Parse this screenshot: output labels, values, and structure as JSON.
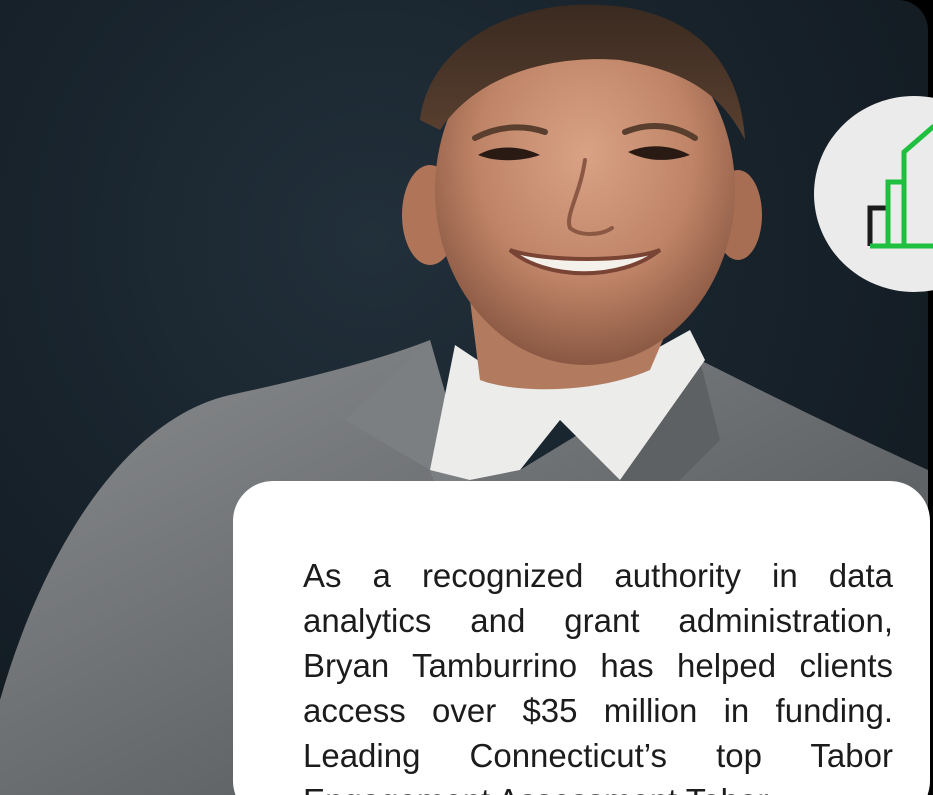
{
  "hero": {
    "photo_alt": "Portrait of Bryan Tamburrino",
    "bio_text": "As a recognized authority in data analytics and grant administration, Bryan Tamburrino has helped clients access over $35 million in funding. Leading Connecticut’s top Tabor Engagement Assessment Tabor..."
  },
  "colors": {
    "background": "#000000",
    "photo_backdrop": "#18232c",
    "suit": "#6b6e70",
    "shirt": "#ececea",
    "skin": "#c08a6e",
    "logo_badge": "#ebebeb",
    "logo_green": "#1fbf3f",
    "logo_dark": "#1c1c1c",
    "card": "#ffffff",
    "text": "#1c1c1c"
  },
  "icons": {
    "logo": "bar-building-logo-icon"
  }
}
